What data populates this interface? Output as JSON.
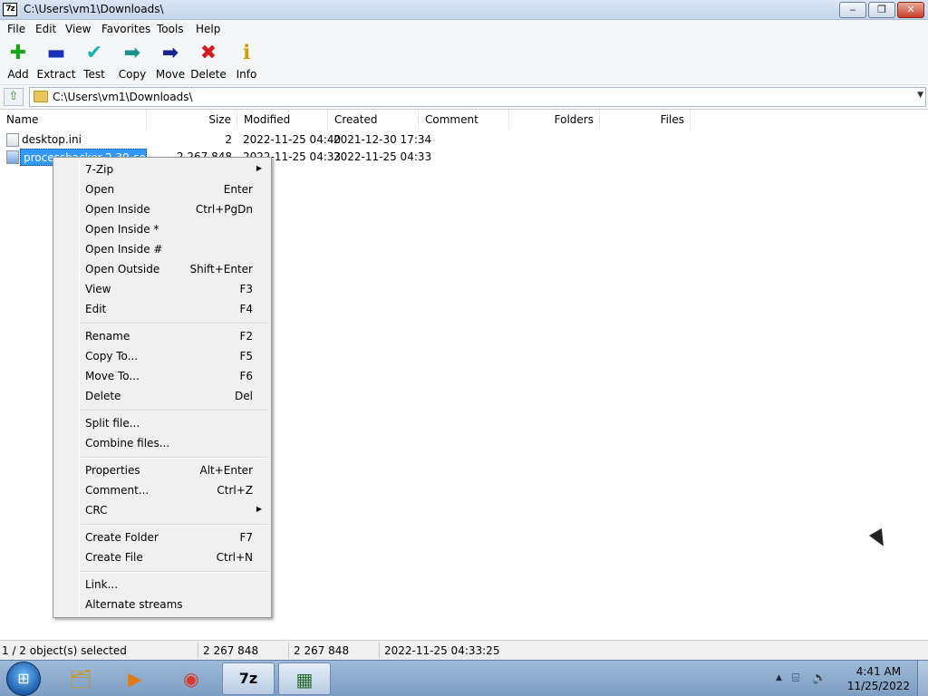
{
  "window": {
    "app_icon_text": "7z",
    "title": "C:\\Users\\vm1\\Downloads\\",
    "minimize": "‒",
    "maximize": "❐",
    "close": "✕"
  },
  "menu": [
    "File",
    "Edit",
    "View",
    "Favorites",
    "Tools",
    "Help"
  ],
  "toolbar": [
    {
      "label": "Add",
      "icon": "plus-icon",
      "glyph": "✚",
      "color": "#1aa51a"
    },
    {
      "label": "Extract",
      "icon": "minus-icon",
      "glyph": "▬",
      "color": "#1a2fb8"
    },
    {
      "label": "Test",
      "icon": "check-icon",
      "glyph": "✔",
      "color": "#17b3b3"
    },
    {
      "label": "Copy",
      "icon": "copy-arrow-icon",
      "glyph": "➡",
      "color": "#1d8f8f"
    },
    {
      "label": "Move",
      "icon": "move-arrow-icon",
      "glyph": "➡",
      "color": "#17238f"
    },
    {
      "label": "Delete",
      "icon": "delete-x-icon",
      "glyph": "✖",
      "color": "#d41b1b"
    },
    {
      "label": "Info",
      "icon": "info-icon",
      "glyph": "ℹ",
      "color": "#c9a000"
    }
  ],
  "address": {
    "path": "C:\\Users\\vm1\\Downloads\\",
    "up_glyph": "⇧",
    "dropdown_glyph": "▼"
  },
  "columns": [
    "Name",
    "Size",
    "Modified",
    "Created",
    "Comment",
    "Folders",
    "Files"
  ],
  "files": [
    {
      "name": "desktop.ini",
      "size": "2",
      "modified": "2022-11-25 04:40",
      "created": "2021-12-30 17:34",
      "selected": false
    },
    {
      "name": "processhacker-2.39-set",
      "size": "2 267 848",
      "modified": "2022-11-25 04:33",
      "created": "2022-11-25 04:33",
      "selected": true
    }
  ],
  "context_menu": [
    {
      "label": "7-Zip",
      "shortcut": "",
      "submenu": true
    },
    {
      "label": "Open",
      "shortcut": "Enter"
    },
    {
      "label": "Open Inside",
      "shortcut": "Ctrl+PgDn"
    },
    {
      "label": "Open Inside *",
      "shortcut": ""
    },
    {
      "label": "Open Inside #",
      "shortcut": ""
    },
    {
      "label": "Open Outside",
      "shortcut": "Shift+Enter"
    },
    {
      "label": "View",
      "shortcut": "F3"
    },
    {
      "label": "Edit",
      "shortcut": "F4"
    },
    {
      "separator": true
    },
    {
      "label": "Rename",
      "shortcut": "F2"
    },
    {
      "label": "Copy To...",
      "shortcut": "F5"
    },
    {
      "label": "Move To...",
      "shortcut": "F6"
    },
    {
      "label": "Delete",
      "shortcut": "Del"
    },
    {
      "separator": true
    },
    {
      "label": "Split file...",
      "shortcut": ""
    },
    {
      "label": "Combine files...",
      "shortcut": ""
    },
    {
      "separator": true
    },
    {
      "label": "Properties",
      "shortcut": "Alt+Enter"
    },
    {
      "label": "Comment...",
      "shortcut": "Ctrl+Z"
    },
    {
      "label": "CRC",
      "shortcut": "",
      "submenu": true
    },
    {
      "separator": true
    },
    {
      "label": "Create Folder",
      "shortcut": "F7"
    },
    {
      "label": "Create File",
      "shortcut": "Ctrl+N"
    },
    {
      "separator": true
    },
    {
      "label": "Link...",
      "shortcut": ""
    },
    {
      "label": "Alternate streams",
      "shortcut": ""
    }
  ],
  "status": {
    "selection": "1 / 2 object(s) selected",
    "size": "2 267 848",
    "total": "2 267 848",
    "date": "2022-11-25 04:33:25"
  },
  "taskbar": {
    "apps": [
      {
        "name": "explorer-icon",
        "glyph": "🗂"
      },
      {
        "name": "media-player-icon",
        "glyph": "▶"
      },
      {
        "name": "chrome-icon",
        "glyph": "◉"
      },
      {
        "name": "7zip-icon",
        "glyph": "7z",
        "active": true
      },
      {
        "name": "process-hacker-icon",
        "glyph": "▦",
        "active": true
      }
    ],
    "time": "4:41 AM",
    "date": "11/25/2022"
  }
}
